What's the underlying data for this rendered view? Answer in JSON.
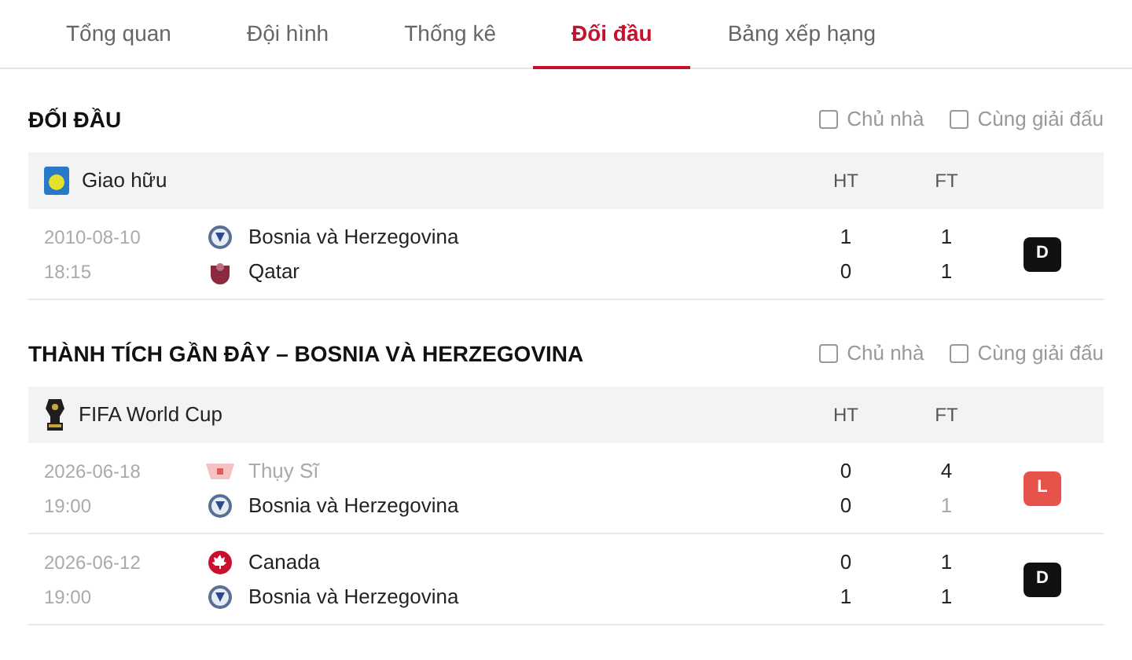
{
  "tabs": [
    {
      "label": "Tổng quan",
      "selected": false
    },
    {
      "label": "Đội hình",
      "selected": false
    },
    {
      "label": "Thống kê",
      "selected": false
    },
    {
      "label": "Đối đầu",
      "selected": true
    },
    {
      "label": "Bảng xếp hạng",
      "selected": false
    }
  ],
  "sections": [
    {
      "title": "ĐỐI ĐẦU",
      "filters": [
        {
          "label": "Chủ nhà",
          "checked": false
        },
        {
          "label": "Cùng giải đấu",
          "checked": false
        }
      ],
      "league": {
        "name": "Giao hữu",
        "kind": "friendly",
        "ht": "HT",
        "ft": "FT"
      },
      "matches": [
        {
          "date": "2010-08-10",
          "time": "18:15",
          "teams": [
            {
              "name": "Bosnia và Herzegovina",
              "kind": "bosnia",
              "muted": false,
              "ht": "1",
              "ft": "1",
              "ft_muted": false
            },
            {
              "name": "Qatar",
              "kind": "qatar",
              "muted": false,
              "ht": "0",
              "ft": "1",
              "ft_muted": false
            }
          ],
          "result": {
            "label": "D",
            "color": "#111111"
          }
        }
      ]
    },
    {
      "title": "THÀNH TÍCH GẦN ĐÂY – BOSNIA VÀ HERZEGOVINA",
      "filters": [
        {
          "label": "Chủ nhà",
          "checked": false
        },
        {
          "label": "Cùng giải đấu",
          "checked": false
        }
      ],
      "league": {
        "name": "FIFA World Cup",
        "kind": "worldcup",
        "ht": "HT",
        "ft": "FT"
      },
      "matches": [
        {
          "date": "2026-06-18",
          "time": "19:00",
          "teams": [
            {
              "name": "Thụy Sĩ",
              "kind": "switzerland",
              "muted": true,
              "ht": "0",
              "ft": "4",
              "ft_muted": false
            },
            {
              "name": "Bosnia và Herzegovina",
              "kind": "bosnia",
              "muted": false,
              "ht": "0",
              "ft": "1",
              "ft_muted": true
            }
          ],
          "result": {
            "label": "L",
            "color": "#e5534b"
          }
        },
        {
          "date": "2026-06-12",
          "time": "19:00",
          "teams": [
            {
              "name": "Canada",
              "kind": "canada",
              "muted": false,
              "ht": "0",
              "ft": "1",
              "ft_muted": false
            },
            {
              "name": "Bosnia và Herzegovina",
              "kind": "bosnia",
              "muted": false,
              "ht": "1",
              "ft": "1",
              "ft_muted": false
            }
          ],
          "result": {
            "label": "D",
            "color": "#111111"
          }
        }
      ]
    }
  ]
}
